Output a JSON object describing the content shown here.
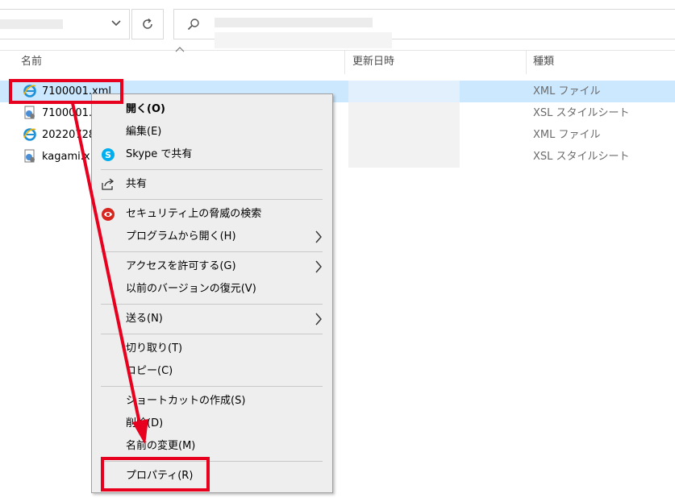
{
  "columns": {
    "name": "名前",
    "modified": "更新日時",
    "type": "種類"
  },
  "files": [
    {
      "name": "7100001.xml",
      "type": "XML ファイル",
      "icon": "ie-xml-icon",
      "selected": true
    },
    {
      "name": "7100001.",
      "type": "XSL スタイルシート",
      "icon": "xsl-file-icon",
      "selected": false
    },
    {
      "name": "20220728",
      "type": "XML ファイル",
      "icon": "ie-xml-icon",
      "selected": false
    },
    {
      "name": "kagami.x",
      "type": "XSL スタイルシート",
      "icon": "xsl-file-icon",
      "selected": false
    }
  ],
  "context_menu": {
    "open": "開く(O)",
    "edit": "編集(E)",
    "skype_share": "Skype で共有",
    "share": "共有",
    "security_scan": "セキュリティ上の脅威の検索",
    "open_with": "プログラムから開く(H)",
    "give_access": "アクセスを許可する(G)",
    "restore_versions": "以前のバージョンの復元(V)",
    "send_to": "送る(N)",
    "cut": "切り取り(T)",
    "copy": "コピー(C)",
    "create_shortcut": "ショートカットの作成(S)",
    "delete": "削除(D)",
    "rename": "名前の変更(M)",
    "properties": "プロパティ(R)"
  },
  "colors": {
    "highlight": "#e8001f",
    "selection": "#cce8ff",
    "menu_bg": "#eeeeee"
  }
}
